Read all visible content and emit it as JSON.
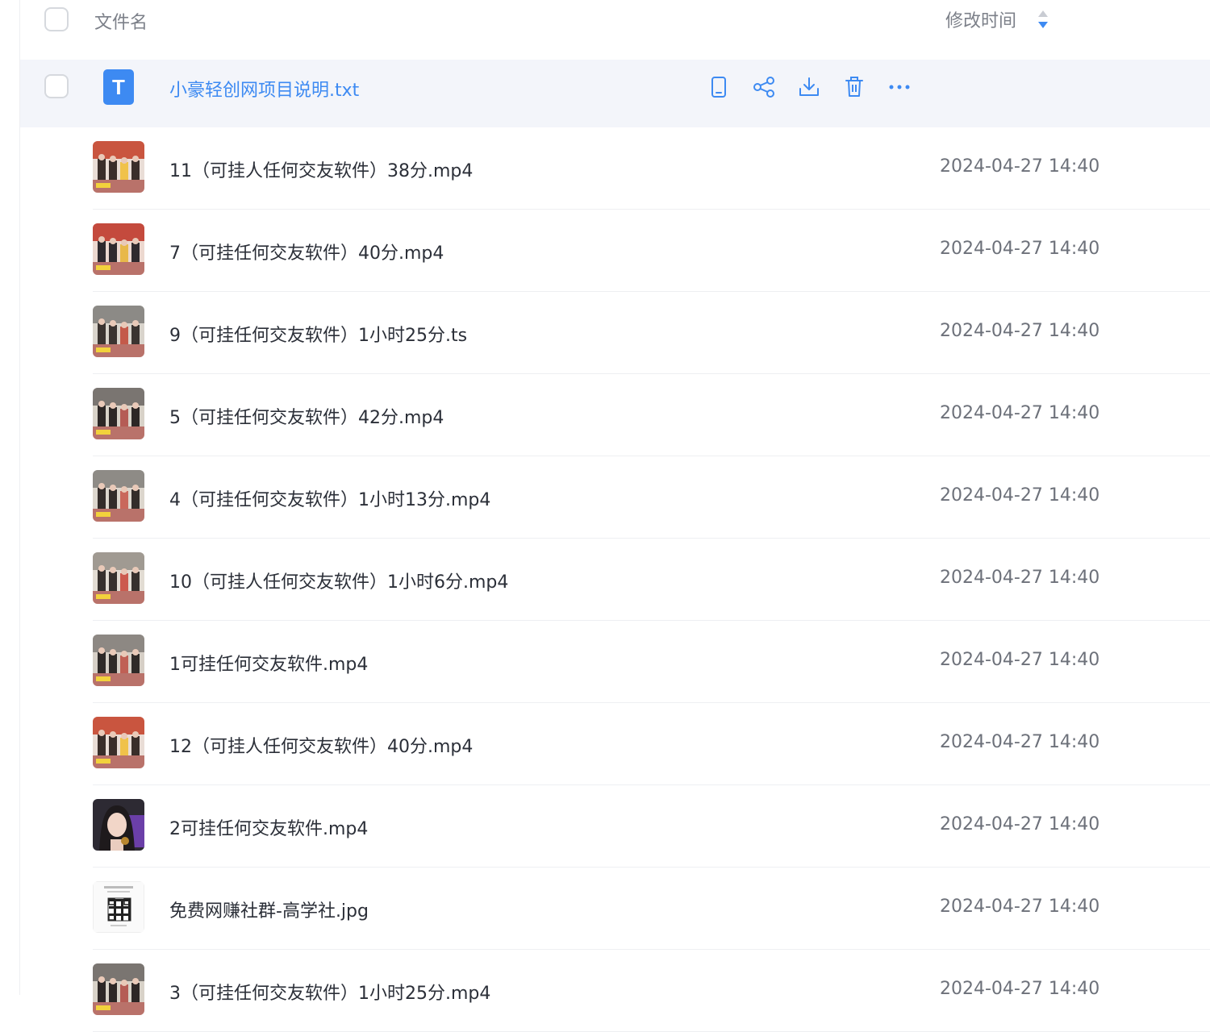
{
  "header": {
    "name_col": "文件名",
    "time_col": "修改时间",
    "sort_icon": "sort-arrows-icon"
  },
  "selected": {
    "icon_letter": "T",
    "name": "小豪轻创网项目说明.txt",
    "actions": [
      {
        "name": "phone-icon"
      },
      {
        "name": "share-icon"
      },
      {
        "name": "download-icon"
      },
      {
        "name": "trash-icon"
      },
      {
        "name": "more-icon"
      }
    ]
  },
  "files": [
    {
      "name": "11（可挂人任何交友软件）38分.mp4",
      "time": "2024-04-27 14:40",
      "thumb": "video-thumbnail"
    },
    {
      "name": "7（可挂任何交友软件）40分.mp4",
      "time": "2024-04-27 14:40",
      "thumb": "video-thumbnail"
    },
    {
      "name": "9（可挂任何交友软件）1小时25分.ts",
      "time": "2024-04-27 14:40",
      "thumb": "video-thumbnail"
    },
    {
      "name": "5（可挂任何交友软件）42分.mp4",
      "time": "2024-04-27 14:40",
      "thumb": "video-thumbnail"
    },
    {
      "name": "4（可挂任何交友软件）1小时13分.mp4",
      "time": "2024-04-27 14:40",
      "thumb": "video-thumbnail"
    },
    {
      "name": "10（可挂人任何交友软件）1小时6分.mp4",
      "time": "2024-04-27 14:40",
      "thumb": "video-thumbnail"
    },
    {
      "name": "1可挂任何交友软件.mp4",
      "time": "2024-04-27 14:40",
      "thumb": "video-thumbnail"
    },
    {
      "name": "12（可挂人任何交友软件）40分.mp4",
      "time": "2024-04-27 14:40",
      "thumb": "video-thumbnail"
    },
    {
      "name": "2可挂任何交友软件.mp4",
      "time": "2024-04-27 14:40",
      "thumb": "portrait-thumbnail"
    },
    {
      "name": "免费网赚社群-高学社.jpg",
      "time": "2024-04-27 14:40",
      "thumb": "qr-code-thumbnail"
    },
    {
      "name": "3（可挂任何交友软件）1小时25分.mp4",
      "time": "2024-04-27 14:40",
      "thumb": "video-thumbnail"
    }
  ]
}
